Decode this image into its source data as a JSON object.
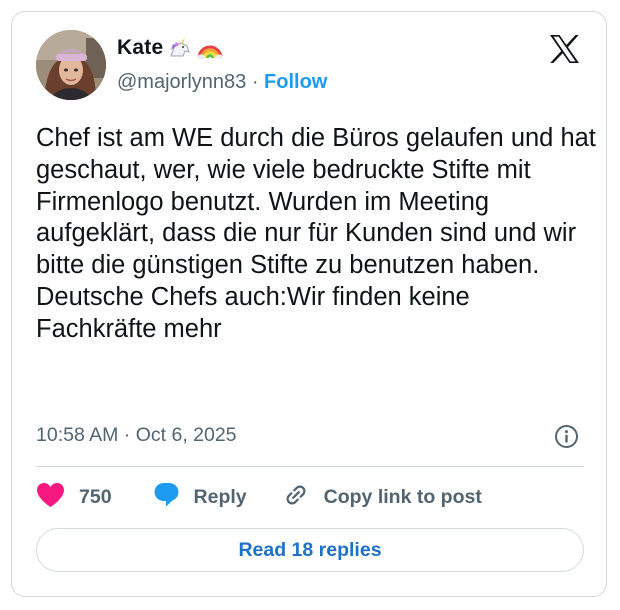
{
  "author": {
    "name": "Kate",
    "handle": "@majorlynn83",
    "separator": "·",
    "follow_label": "Follow"
  },
  "tweet": {
    "text": "Chef ist am WE durch die Büros gelaufen und hat geschaut, wer, wie viele bedruckte Stifte mit Firmenlogo benutzt. Wurden im Meeting aufgeklärt, dass die nur für Kunden sind und wir bitte die günstigen Stifte zu benutzen haben. Deutsche Chefs auch:Wir finden keine Fachkräfte mehr",
    "timestamp": "10:58 AM · Oct 6, 2025"
  },
  "actions": {
    "like_count": "750",
    "reply_label": "Reply",
    "copy_label": "Copy link to post"
  },
  "footer": {
    "read_replies_label": "Read 18 replies"
  },
  "icons": {
    "name_emojis": [
      "unicorn-emoji",
      "rainbow-emoji"
    ],
    "platform": "x-logo-icon",
    "info": "info-icon",
    "like": "heart-icon",
    "reply": "speech-bubble-icon",
    "copy": "link-icon"
  },
  "colors": {
    "accent": "#1d9bf0",
    "like": "#f91880",
    "text": "#0f1419",
    "muted": "#536471",
    "border": "#cfd9de"
  }
}
